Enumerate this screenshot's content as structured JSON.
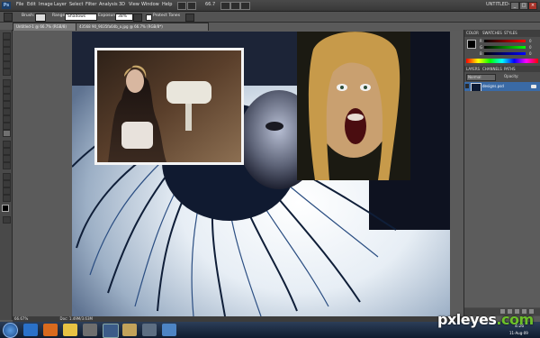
{
  "menubar": {
    "logo": "Ps",
    "items": [
      "File",
      "Edit",
      "Image",
      "Layer",
      "Select",
      "Filter",
      "Analysis",
      "3D",
      "View",
      "Window",
      "Help"
    ],
    "zoom_label": "66.7",
    "workspace_label": "UNTITLED-1",
    "win_buttons": [
      "_",
      "□",
      "×"
    ]
  },
  "options": {
    "brush_label": "Brush:",
    "range_label": "Range:",
    "range_value": "Shadows",
    "exposure_label": "Exposure:",
    "exposure_value": "38%",
    "protect_label": "Protect Tones"
  },
  "tabs": {
    "active": "Untitled-1 @ 66.7% (RGB/8)",
    "second": "43568 90_9035fa64b_o.jpg @ 66.7% (RGB/8*)"
  },
  "panels": {
    "color_tabs": [
      "COLOR",
      "SWATCHES",
      "STYLES"
    ],
    "rgb_labels": [
      "R",
      "G",
      "B"
    ],
    "rgb_values": [
      "0",
      "0",
      "0"
    ],
    "layers_tabs": [
      "LAYERS",
      "CHANNELS",
      "PATHS"
    ],
    "blend_mode": "Normal",
    "opacity_label": "Opacity:",
    "layer_name": "designs.psd"
  },
  "status": {
    "zoom": "66.67%",
    "doc": "Doc: 1.49M/3.63M"
  },
  "taskbar": {
    "clock_time": "4:26",
    "clock_date": "11-Aug-09"
  },
  "watermark": {
    "text": "pxleyes",
    "dotcom": ".com"
  },
  "colors": {
    "accent": "#1b3f6b",
    "layer_selected": "#3a6aa6",
    "watermark_green": "#6cbf2a"
  }
}
